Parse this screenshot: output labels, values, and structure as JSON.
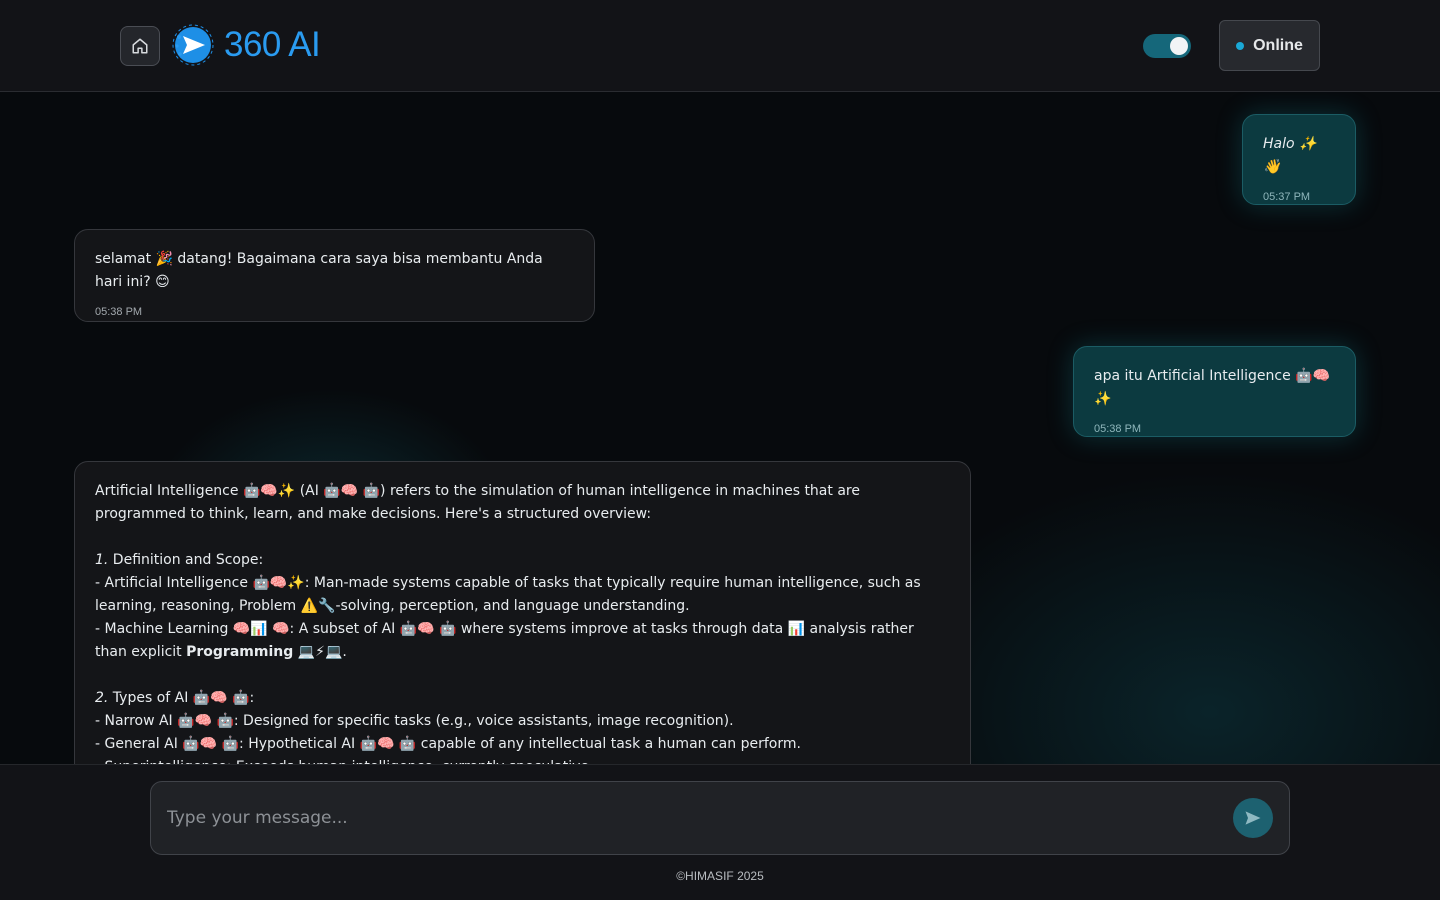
{
  "header": {
    "brand": "360 AI",
    "theme_toggle_on": true,
    "status_label": "Online",
    "status_color": "#1aa8d6",
    "brand_color": "#2a9bf0"
  },
  "messages": [
    {
      "role": "user",
      "text": "Halo ✨ 👋",
      "time": "05:37 PM"
    },
    {
      "role": "bot",
      "text": "selamat 🎉 datang! Bagaimana cara saya bisa membantu Anda hari ini? 😊",
      "time": "05:38 PM"
    },
    {
      "role": "user",
      "text": "apa itu Artificial Intelligence 🤖🧠✨",
      "time": "05:38 PM"
    },
    {
      "role": "bot",
      "intro": "Artificial Intelligence 🤖🧠✨ (AI 🤖🧠 🤖) refers to the simulation of human intelligence in machines that are programmed to think, learn, and make decisions. Here's a structured overview:",
      "section1_num": "1.",
      "section1_title": " Definition and Scope:",
      "s1_line1": "- Artificial Intelligence 🤖🧠✨: Man-made systems capable of tasks that typically require human intelligence, such as learning, reasoning, Problem ⚠️🔧-solving, perception, and language understanding.",
      "s1_line2_pre": "- Machine Learning 🧠📊 🧠: A subset of AI 🤖🧠 🤖 where systems improve at tasks through data 📊 analysis rather than explicit ",
      "s1_line2_bold": "Programming",
      "s1_line2_post": " 💻⚡💻.",
      "section2_num": "2.",
      "section2_title": " Types of AI 🤖🧠 🤖:",
      "s2_line1": "- Narrow AI 🤖🧠 🤖: Designed for specific tasks (e.g., voice assistants, image recognition).",
      "s2_line2": "- General AI 🤖🧠 🤖: Hypothetical AI 🤖🧠 🤖 capable of any intellectual task a human can perform.",
      "s2_line3": "- Superintelligence: Exceeds human intelligence, currently speculative."
    }
  ],
  "input": {
    "placeholder": "Type your message..."
  },
  "footer": {
    "copyright": "©HIMASIF 2025"
  }
}
